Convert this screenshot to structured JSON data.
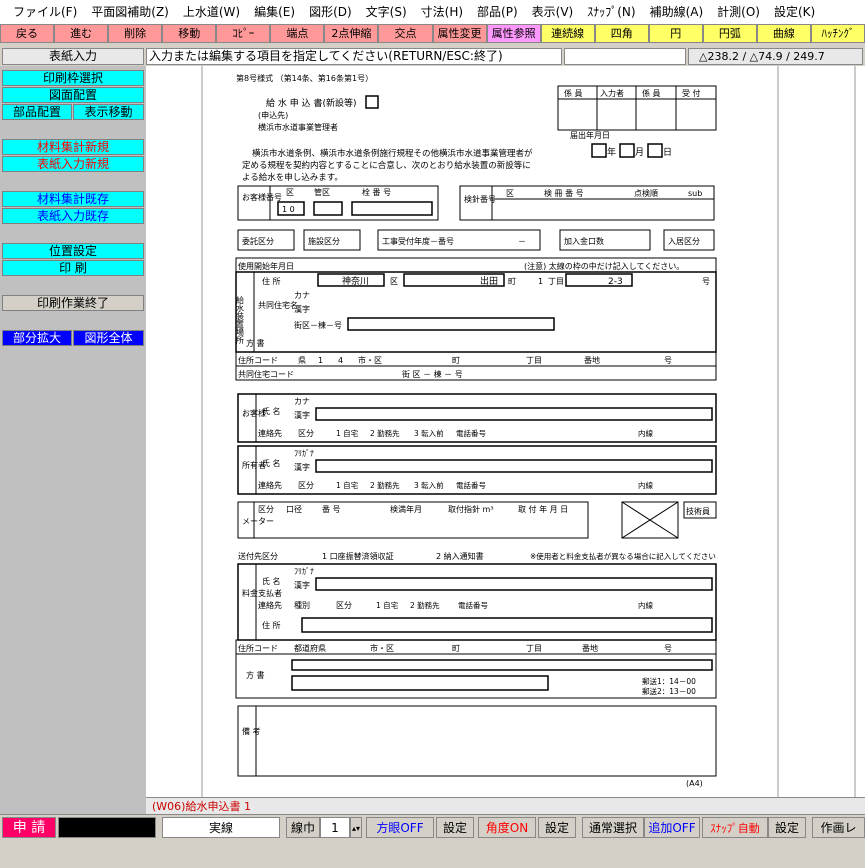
{
  "menu": [
    "ファイル(F)",
    "平面図補助(Z)",
    "上水道(W)",
    "編集(E)",
    "図形(D)",
    "文字(S)",
    "寸法(H)",
    "部品(P)",
    "表示(V)",
    "ｽﾅｯﾌﾟ(N)",
    "補助線(A)",
    "計測(O)",
    "設定(K)"
  ],
  "toolbar": [
    {
      "label": "戻る",
      "bg": "#ff9999",
      "fg": "#000"
    },
    {
      "label": "進む",
      "bg": "#ff9999",
      "fg": "#000"
    },
    {
      "label": "削除",
      "bg": "#ff9999",
      "fg": "#000"
    },
    {
      "label": "移動",
      "bg": "#ff9999",
      "fg": "#000"
    },
    {
      "label": "ｺﾋﾟｰ",
      "bg": "#ff9999",
      "fg": "#000"
    },
    {
      "label": "端点",
      "bg": "#ff9999",
      "fg": "#000"
    },
    {
      "label": "2点伸縮",
      "bg": "#ff9999",
      "fg": "#000"
    },
    {
      "label": "交点",
      "bg": "#ff9999",
      "fg": "#000"
    },
    {
      "label": "属性変更",
      "bg": "#ff9999",
      "fg": "#000"
    },
    {
      "label": "属性参照",
      "bg": "#ff99ff",
      "fg": "#000"
    },
    {
      "label": "連続線",
      "bg": "#ffff66",
      "fg": "#000"
    },
    {
      "label": "四角",
      "bg": "#ffff66",
      "fg": "#000"
    },
    {
      "label": "円",
      "bg": "#ffff66",
      "fg": "#000"
    },
    {
      "label": "円弧",
      "bg": "#ffff66",
      "fg": "#000"
    },
    {
      "label": "曲線",
      "bg": "#ffff66",
      "fg": "#000"
    },
    {
      "label": "ﾊｯﾁﾝｸﾞ",
      "bg": "#ffff66",
      "fg": "#000"
    }
  ],
  "status": {
    "mode": "表紙入力",
    "prompt": "入力または編集する項目を指定してください(RETURN/ESC:終了)",
    "coords": "△238.2 / △74.9 / 249.7"
  },
  "sidebar": {
    "print_frame": "印刷枠選択",
    "layout": "図面配置",
    "parts_layout": "部品配置",
    "view_move": "表示移動",
    "mat_calc_new": "材料集計新規",
    "cover_new": "表紙入力新規",
    "mat_calc_existing": "材料集計既存",
    "cover_existing": "表紙入力既存",
    "position": "位置設定",
    "print": "印 刷",
    "print_end": "印刷作業終了",
    "zoom_part": "部分拡大",
    "zoom_all": "図形全体"
  },
  "tab": "(W06)給水申込書 1",
  "bottom": {
    "app": "申 請",
    "line_type": "実線",
    "line_width_label": "線巾",
    "line_width": "1",
    "grid": "方眼OFF",
    "settings1": "設定",
    "angle": "角度ON",
    "settings2": "設定",
    "normal_select": "通常選択",
    "add": "追加OFF",
    "snap": "ｽﾅｯﾌﾟ自動",
    "settings3": "設定",
    "draw_layer": "作画レ"
  },
  "form": {
    "header_small": "第8号様式 （第14条、第16条第1号）",
    "title": "給 水 申 込 書(新設等)",
    "to1": "(申込先)",
    "to2": "横浜市水道事業管理者",
    "staff_headers": [
      "係 員",
      "入力者",
      "係 員",
      "受 付"
    ],
    "date_label": "届出年月日",
    "year": "年",
    "month": "月",
    "day": "日",
    "body1": "横浜市水道条例、横浜市水道条例施行規程その他横浜市水道事業管理者が",
    "body2": "定める規程を契約内容とすることに合意し、次のとおり給水装置の新設等に",
    "body3": "よる給水を申し込みます。",
    "customer_no": "お客様番号",
    "ku": "区",
    "kanku": "管区",
    "seq": "栓 番 号",
    "kenshin": "検針番号",
    "book_no": "検 冊 番 号",
    "order": "点検順",
    "sub": "sub",
    "prefix": "1 0",
    "commission": "委託区分",
    "install": "施設区分",
    "construction": "工事受付年度－番号",
    "dash": "－",
    "join_fee": "加入金口数",
    "move_in": "入居区分",
    "start_date": "使用開始年月日",
    "note": "(注意) 太線の枠の中だけ記入してください。",
    "supply_place": "給水装置場所",
    "address": "住 所",
    "city": "神奈川",
    "ku2": "区",
    "town": "出田",
    "machi": "町",
    "one": "1",
    "chome": "丁目",
    "banchi": "2-3",
    "go": "号",
    "kyodo": "共同住宅名",
    "kana": "カナ",
    "kanji": "漢字",
    "block": "街区－棟－号",
    "katagaki": "方 書",
    "addr_code": "住所コード",
    "ken": "県",
    "ken_no": "1",
    "ken_no2": "4",
    "shiku": "市・区",
    "cho": "町",
    "chome2": "丁目",
    "banchi2": "番地",
    "go2": "号",
    "kyodo_code": "共同住宅コード",
    "block2": "街 区 － 棟 － 号",
    "customer": "お客様",
    "name": "氏 名",
    "furigana": "ﾌﾘｶﾞﾅ",
    "contact": "連絡先",
    "kubun": "区分",
    "home": "1 自宅",
    "work": "2 勤務先",
    "mobile": "3 転入前",
    "phone": "電話番号",
    "ext": "内線",
    "owner": "所有者",
    "meter": "メーター",
    "kubun2": "区分",
    "diameter": "口径",
    "number": "番 号",
    "test_ym": "検満年月",
    "install_guide": "取付指針 m³",
    "install_date": "取 付 年 月 日",
    "tech": "技術員",
    "send": "送付先区分",
    "send1": "1 口座振替済領収証",
    "send2": "2 納入通知書",
    "send_note": "※使用者と料金支払者が異なる場合に記入してください",
    "payer": "料金支払者",
    "category": "種別",
    "addr2": "住 所",
    "addr_code2": "住所コード",
    "pref": "都道府県",
    "shiku2": "市・区",
    "cho2": "町",
    "chome3": "丁目",
    "banchi3": "番地",
    "go3": "号",
    "katagaki2": "方 書",
    "hosou1": "郵送1：14－00",
    "hosou2": "郵送2：13－00",
    "remarks": "備 考",
    "paper": "(A4)"
  }
}
